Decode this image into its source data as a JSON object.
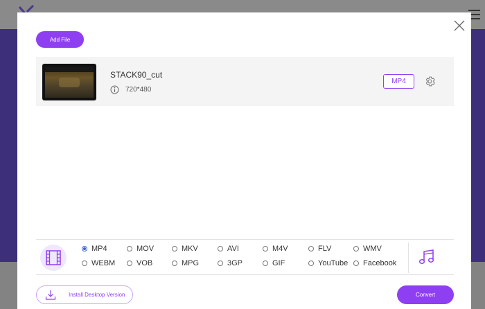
{
  "toolbar": {
    "add_file_label": "Add File"
  },
  "file": {
    "name": "STACK90_cut",
    "resolution": "720*480",
    "output_format": "MP4"
  },
  "formats": {
    "selected": "MP4",
    "row1": [
      "MP4",
      "MOV",
      "MKV",
      "AVI",
      "M4V",
      "FLV",
      "WMV"
    ],
    "row2": [
      "WEBM",
      "VOB",
      "MPG",
      "3GP",
      "GIF",
      "YouTube",
      "Facebook"
    ]
  },
  "footer": {
    "install_label": "Install Desktop Version",
    "convert_label": "Convert"
  },
  "colors": {
    "accent": "#8f3ff2",
    "radio_selected": "#3b63d1",
    "backdrop_band": "#3d2f7a"
  },
  "icons": {
    "logo": "logo-icon",
    "menu": "hamburger-menu-icon",
    "close": "close-icon",
    "info": "info-icon",
    "settings": "gear-icon",
    "video": "film-icon",
    "audio": "music-note-icon",
    "download": "download-icon"
  }
}
